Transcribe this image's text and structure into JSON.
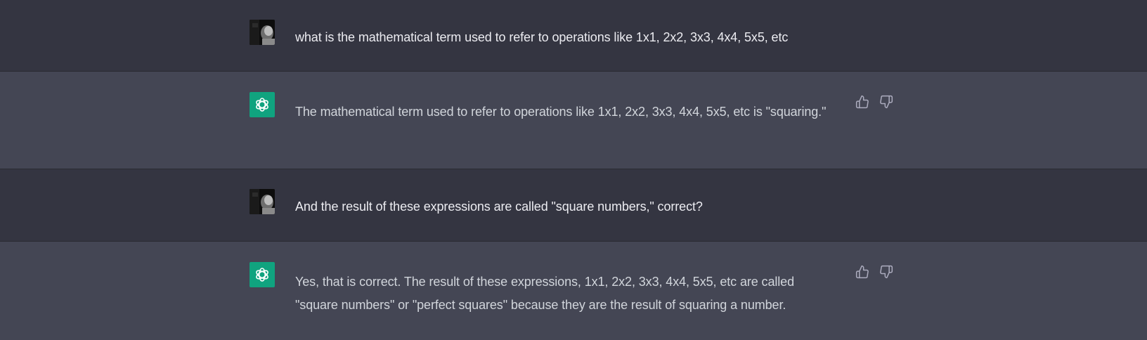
{
  "conversation": {
    "messages": [
      {
        "role": "user",
        "text": "what is the mathematical term used to refer to operations like 1x1, 2x2, 3x3, 4x4, 5x5, etc"
      },
      {
        "role": "assistant",
        "text": "The mathematical term used to refer to operations like 1x1, 2x2, 3x3, 4x4, 5x5, etc is \"squaring.\""
      },
      {
        "role": "user",
        "text": "And the result of these expressions are called \"square numbers,\" correct?"
      },
      {
        "role": "assistant",
        "text": "Yes, that is correct. The result of these expressions, 1x1, 2x2, 3x3, 4x4, 5x5, etc are called \"square numbers\" or \"perfect squares\" because they are the result of squaring a number."
      }
    ]
  },
  "icons": {
    "assistant_avatar": "openai-logo-icon",
    "thumbs_up": "thumbs-up-icon",
    "thumbs_down": "thumbs-down-icon"
  },
  "colors": {
    "user_bg": "#343541",
    "assistant_bg": "#444654",
    "assistant_avatar_bg": "#10a37f"
  }
}
